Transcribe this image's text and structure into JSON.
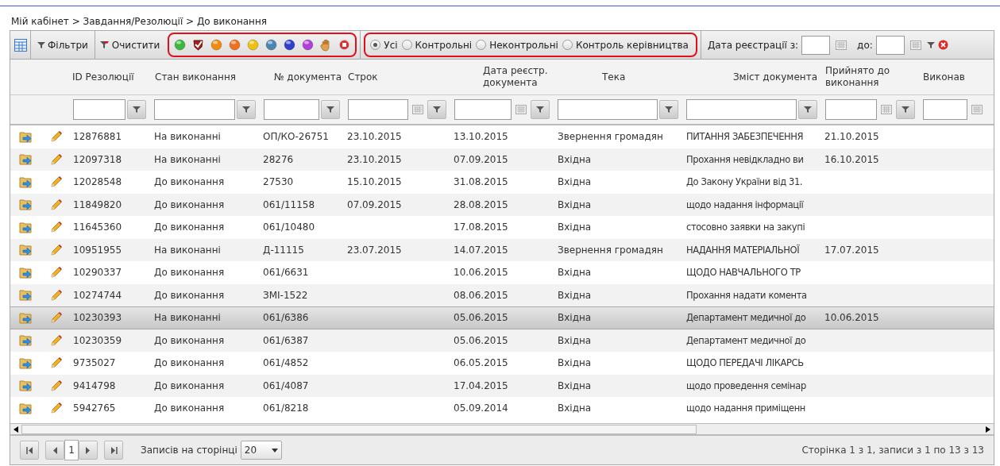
{
  "breadcrumb": "Мій кабінет > Завдання/Резолюції > До виконання",
  "toolbar": {
    "filters_button": "Фільтри",
    "clear_button": "Очистити",
    "radios": [
      {
        "label": "Усі",
        "selected": true
      },
      {
        "label": "Контрольні",
        "selected": false
      },
      {
        "label": "Неконтрольні",
        "selected": false
      },
      {
        "label": "Контроль керівництва",
        "selected": false
      }
    ],
    "date_from_label": "Дата реєстрації з:",
    "date_to_label": "до:"
  },
  "columns": [
    {
      "label": "ID Резолюції",
      "kind": "text"
    },
    {
      "label": "Стан виконання",
      "kind": "text"
    },
    {
      "label": "№ документа",
      "kind": "text"
    },
    {
      "label": "Строк",
      "kind": "date"
    },
    {
      "label": "Дата реєстр. документа",
      "kind": "date"
    },
    {
      "label": "Тека",
      "kind": "text"
    },
    {
      "label": "Зміст документа",
      "kind": "text"
    },
    {
      "label": "Прийнято до виконання",
      "kind": "date"
    },
    {
      "label": "Виконав",
      "kind": "partial"
    }
  ],
  "rows": [
    {
      "cells": [
        "12876881",
        "На виконанні",
        "ОП/КО-26751",
        "23.10.2015",
        "13.10.2015",
        "Звернення громадян",
        "ПИТАННЯ ЗАБЕЗПЕЧЕННЯ",
        "21.10.2015"
      ],
      "selected": false
    },
    {
      "cells": [
        "12097318",
        "На виконанні",
        "28276",
        "23.10.2015",
        "07.09.2015",
        "Вхідна",
        "Прохання невідкладно ви",
        "16.10.2015"
      ],
      "selected": false
    },
    {
      "cells": [
        "12028548",
        "До виконання",
        "27530",
        "15.10.2015",
        "31.08.2015",
        "Вхідна",
        "До Закону України від 31.",
        ""
      ],
      "selected": false
    },
    {
      "cells": [
        "11849820",
        "До виконання",
        "061/11158",
        "07.09.2015",
        "28.08.2015",
        "Вхідна",
        "щодо надання інформації",
        ""
      ],
      "selected": false
    },
    {
      "cells": [
        "11645360",
        "До виконання",
        "061/10480",
        "",
        "17.08.2015",
        "Вхідна",
        "стосовно заявки на закупі",
        ""
      ],
      "selected": false
    },
    {
      "cells": [
        "10951955",
        "На виконанні",
        "Д-11115",
        "23.07.2015",
        "14.07.2015",
        "Звернення громадян",
        "НАДАННЯ МАТЕРІАЛЬНОЇ",
        "17.07.2015"
      ],
      "selected": false
    },
    {
      "cells": [
        "10290337",
        "До виконання",
        "061/6631",
        "",
        "10.06.2015",
        "Вхідна",
        "ЩОДО НАВЧАЛЬНОГО ТР",
        ""
      ],
      "selected": false
    },
    {
      "cells": [
        "10274744",
        "До виконання",
        "ЗМІ-1522",
        "",
        "08.06.2015",
        "Вхідна",
        "Прохання надати комента",
        ""
      ],
      "selected": false
    },
    {
      "cells": [
        "10230393",
        "На виконанні",
        "061/6386",
        "",
        "05.06.2015",
        "Вхідна",
        "Департамент медичної до",
        "10.06.2015"
      ],
      "selected": true
    },
    {
      "cells": [
        "10230359",
        "До виконання",
        "061/6387",
        "",
        "05.06.2015",
        "Вхідна",
        "Департамент медичної до",
        ""
      ],
      "selected": false
    },
    {
      "cells": [
        "9735027",
        "До виконання",
        "061/4852",
        "",
        "06.05.2015",
        "Вхідна",
        "ЩОДО ПЕРЕДАЧІ ЛІКАРСЬ",
        ""
      ],
      "selected": false
    },
    {
      "cells": [
        "9414798",
        "До виконання",
        "061/4087",
        "",
        "17.04.2015",
        "Вхідна",
        "щодо проведення семінар",
        ""
      ],
      "selected": false
    },
    {
      "cells": [
        "5942765",
        "До виконання",
        "061/8218",
        "",
        "05.09.2014",
        "Вхідна",
        "щодо надання приміщенн",
        ""
      ],
      "selected": false
    }
  ],
  "pager": {
    "page": "1",
    "per_page_label": "Записів на сторінці",
    "per_page": "20",
    "summary": "Сторінка 1 з 1, записи з 1 по 13 з 13"
  }
}
